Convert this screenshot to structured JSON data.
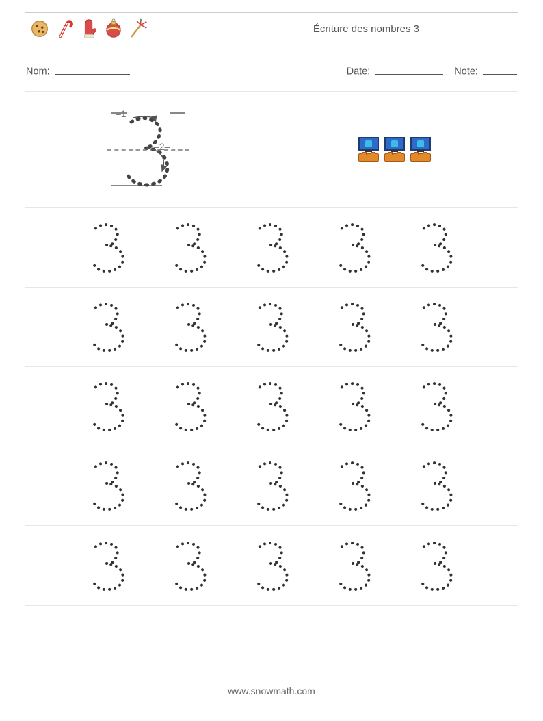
{
  "header": {
    "title": "Écriture des nombres 3",
    "icons": [
      "cookie-icon",
      "candy-cane-icon",
      "mitten-icon",
      "bauble-icon",
      "firework-icon"
    ]
  },
  "meta": {
    "name_label": "Nom:",
    "date_label": "Date:",
    "note_label": "Note:"
  },
  "demo": {
    "stroke_labels": {
      "first": "1",
      "second": "2"
    },
    "count": 3
  },
  "practice": {
    "rows": 5,
    "cols": 5,
    "digit": "3"
  },
  "footer": {
    "url": "www.snowmath.com"
  },
  "colors": {
    "border": "#e6e6e6",
    "text": "#555",
    "dot": "#333333"
  }
}
